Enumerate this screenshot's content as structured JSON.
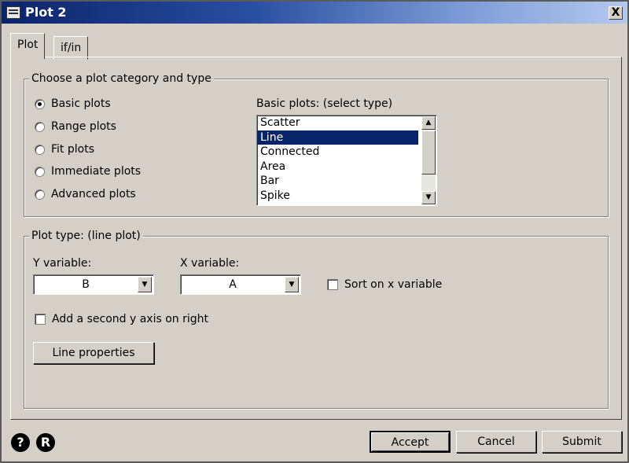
{
  "window": {
    "title": "Plot 2",
    "close_label": "X"
  },
  "tabs": [
    {
      "label": "Plot",
      "active": true
    },
    {
      "label": "if/in",
      "active": false
    }
  ],
  "category_group": {
    "legend": "Choose a plot category and type",
    "radios": [
      {
        "label": "Basic plots",
        "checked": true
      },
      {
        "label": "Range plots",
        "checked": false
      },
      {
        "label": "Fit plots",
        "checked": false
      },
      {
        "label": "Immediate plots",
        "checked": false
      },
      {
        "label": "Advanced plots",
        "checked": false
      }
    ],
    "list_label": "Basic plots: (select type)",
    "list_items": [
      "Scatter",
      "Line",
      "Connected",
      "Area",
      "Bar",
      "Spike"
    ],
    "selected_item": "Line"
  },
  "plot_type_group": {
    "legend": "Plot type: (line plot)",
    "y_label": "Y variable:",
    "y_value": "B",
    "x_label": "X variable:",
    "x_value": "A",
    "sort_label": "Sort on x variable",
    "sort_checked": false,
    "second_axis_label": "Add a second y axis on right",
    "second_axis_checked": false,
    "line_properties_label": "Line properties"
  },
  "footer": {
    "help_icon": "?",
    "r_icon": "R",
    "accept_label": "Accept",
    "cancel_label": "Cancel",
    "submit_label": "Submit"
  },
  "colors": {
    "titlebar_start": "#0a246a",
    "dialog_face": "#d4d0c8",
    "selection": "#0a246a"
  }
}
